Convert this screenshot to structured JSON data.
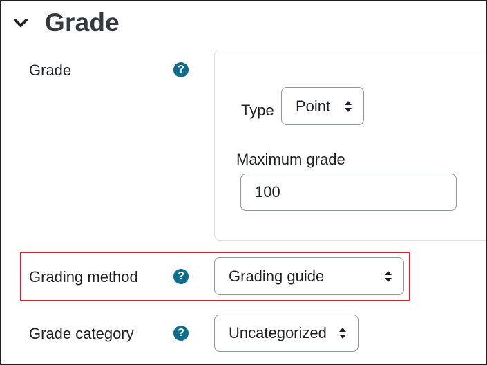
{
  "section": {
    "title": "Grade"
  },
  "fields": {
    "grade": {
      "label": "Grade",
      "help": "?",
      "type_label": "Type",
      "type_value": "Point",
      "max_label": "Maximum grade",
      "max_value": "100"
    },
    "grading_method": {
      "label": "Grading method",
      "help": "?",
      "value": "Grading guide"
    },
    "grade_category": {
      "label": "Grade category",
      "help": "?",
      "value": "Uncategorized"
    }
  },
  "colors": {
    "help_icon": "#0f6c8a",
    "highlight_border": "#e0202a",
    "input_border": "#8f959e"
  }
}
